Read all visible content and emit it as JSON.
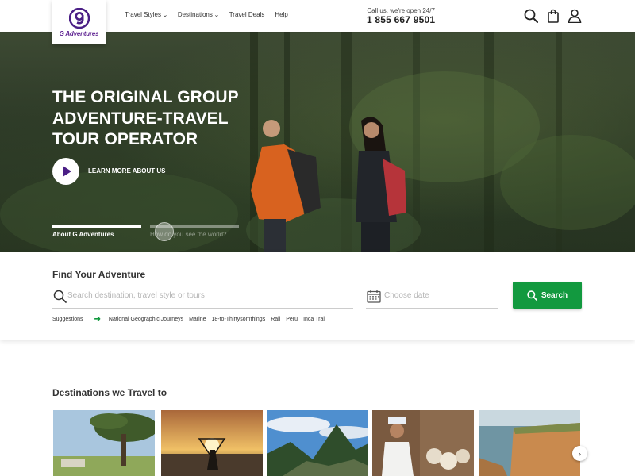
{
  "header": {
    "logo_text": "G Adventures",
    "nav": [
      {
        "label": "Travel Styles",
        "has_dropdown": true
      },
      {
        "label": "Destinations",
        "has_dropdown": true
      },
      {
        "label": "Travel Deals",
        "has_dropdown": false
      },
      {
        "label": "Help",
        "has_dropdown": false
      }
    ],
    "call_label": "Call us, we're open 24/7",
    "call_phone": "1 855 667 9501",
    "icons": [
      "search-icon",
      "bag-icon",
      "account-icon"
    ]
  },
  "hero": {
    "title_line1": "THE ORIGINAL GROUP",
    "title_line2": "ADVENTURE-TRAVEL",
    "title_line3": "TOUR OPERATOR",
    "learn_more": "LEARN MORE ABOUT US",
    "tabs": [
      {
        "label": "About G Adventures",
        "active": true
      },
      {
        "label": "How do you see the world?",
        "active": false
      }
    ]
  },
  "search": {
    "title": "Find Your Adventure",
    "destination_placeholder": "Search destination, travel style or tours",
    "date_placeholder": "Choose date",
    "button_label": "Search",
    "suggestions_label": "Suggestions",
    "suggestions": [
      "National Geographic Journeys",
      "Marine",
      "18-to-Thirtysomthings",
      "Rail",
      "Peru",
      "Inca Trail"
    ]
  },
  "destinations": {
    "title": "Destinations we Travel to"
  },
  "colors": {
    "brand_purple": "#4b1f86",
    "accent_green": "#12993f"
  }
}
